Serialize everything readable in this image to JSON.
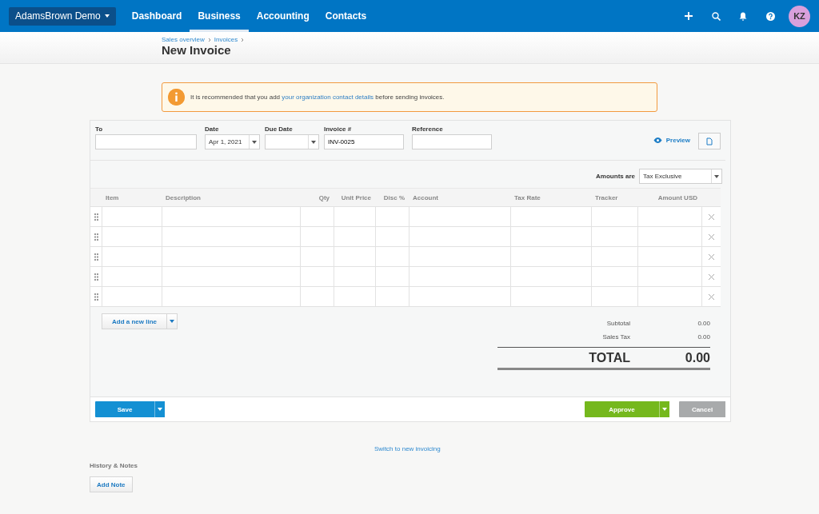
{
  "nav": {
    "org": "AdamsBrown Demo",
    "tabs": [
      {
        "label": "Dashboard",
        "selected": false
      },
      {
        "label": "Business",
        "selected": true
      },
      {
        "label": "Accounting",
        "selected": false
      },
      {
        "label": "Contacts",
        "selected": false
      }
    ],
    "avatar": "KZ"
  },
  "breadcrumb": [
    "Sales overview",
    "Invoices"
  ],
  "title": "New Invoice",
  "alert": {
    "before": "It is recommended that you add",
    "link": "your organization contact details",
    "after": "before sending invoices."
  },
  "fields": {
    "to": {
      "label": "To"
    },
    "date": {
      "label": "Date",
      "value": "Apr 1, 2021"
    },
    "due": {
      "label": "Due Date"
    },
    "number": {
      "label": "Invoice #",
      "value": "INV-0025"
    },
    "reference": {
      "label": "Reference"
    }
  },
  "preview": "Preview",
  "amounts": {
    "label": "Amounts are",
    "value": "Tax Exclusive"
  },
  "columns": [
    "Item",
    "Description",
    "Qty",
    "Unit Price",
    "Disc %",
    "Account",
    "Tax Rate",
    "Tracker",
    "Amount USD"
  ],
  "rows": [
    {
      "deletable": true
    },
    {
      "deletable": true
    },
    {
      "deletable": true
    },
    {
      "deletable": true
    },
    {
      "deletable": true
    }
  ],
  "add_line": "Add a new line",
  "totals": [
    {
      "label": "Subtotal",
      "value": "0.00"
    },
    {
      "label": "Sales Tax",
      "value": "0.00"
    }
  ],
  "total": {
    "label": "TOTAL",
    "value": "0.00"
  },
  "buttons": {
    "save": "Save",
    "approve": "Approve",
    "cancel": "Cancel"
  },
  "switch_link": "Switch to new invoicing",
  "history": {
    "title": "History & Notes",
    "button": "Add Note"
  }
}
